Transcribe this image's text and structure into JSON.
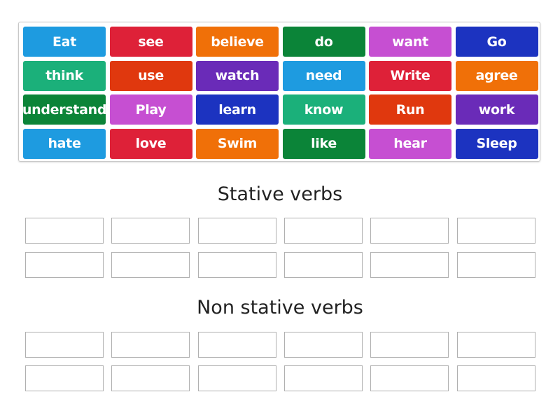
{
  "tiles": [
    {
      "label": "Eat",
      "color": "#1e9be0"
    },
    {
      "label": "see",
      "color": "#de2138"
    },
    {
      "label": "believe",
      "color": "#f07008"
    },
    {
      "label": "do",
      "color": "#0b8438"
    },
    {
      "label": "want",
      "color": "#c64fd2"
    },
    {
      "label": "Go",
      "color": "#1c33c0"
    },
    {
      "label": "think",
      "color": "#1bb07a"
    },
    {
      "label": "use",
      "color": "#e0380e"
    },
    {
      "label": "watch",
      "color": "#6a2bb8"
    },
    {
      "label": "need",
      "color": "#1e9be0"
    },
    {
      "label": "Write",
      "color": "#de2138"
    },
    {
      "label": "agree",
      "color": "#f07008"
    },
    {
      "label": "understand",
      "color": "#0b8438"
    },
    {
      "label": "Play",
      "color": "#c64fd2"
    },
    {
      "label": "learn",
      "color": "#1c33c0"
    },
    {
      "label": "know",
      "color": "#1bb07a"
    },
    {
      "label": "Run",
      "color": "#e0380e"
    },
    {
      "label": "work",
      "color": "#6a2bb8"
    },
    {
      "label": "hate",
      "color": "#1e9be0"
    },
    {
      "label": "love",
      "color": "#de2138"
    },
    {
      "label": "Swim",
      "color": "#f07008"
    },
    {
      "label": "like",
      "color": "#0b8438"
    },
    {
      "label": "hear",
      "color": "#c64fd2"
    },
    {
      "label": "Sleep",
      "color": "#1c33c0"
    }
  ],
  "groups": [
    {
      "title": "Stative verbs",
      "slots": 12
    },
    {
      "title": "Non stative verbs",
      "slots": 12
    }
  ]
}
